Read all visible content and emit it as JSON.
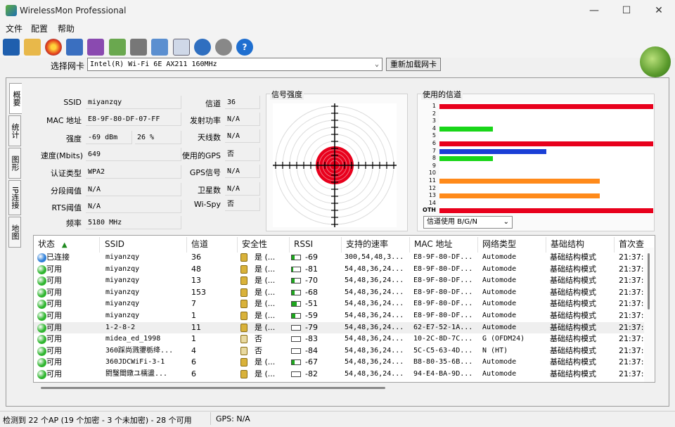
{
  "window": {
    "title": "WirelessMon Professional",
    "minimize": "—",
    "maximize": "☐",
    "close": "✕"
  },
  "menu": {
    "file": "文件",
    "config": "配置",
    "help": "帮助"
  },
  "adapter": {
    "label": "选择网卡",
    "value": "Intel(R) Wi-Fi 6E AX211 160MHz",
    "reload": "重新加载网卡"
  },
  "tabs": [
    "概要",
    "统计",
    "图形",
    "IP连接",
    "地图"
  ],
  "summary": {
    "ssid_label": "SSID",
    "ssid": "miyanzqy",
    "mac_label": "MAC 地址",
    "mac": "E8-9F-80-DF-07-FF",
    "strength_label": "强度",
    "strength_dbm": "-69 dBm",
    "strength_pct": "26 %",
    "speed_label": "速度(Mbits)",
    "speed": "649",
    "auth_label": "认证类型",
    "auth": "WPA2",
    "frag_label": "分段阈值",
    "frag": "N/A",
    "rts_label": "RTS阈值",
    "rts": "N/A",
    "freq_label": "频率",
    "freq": "5180 MHz",
    "channel_label": "信道",
    "channel": "36",
    "txpower_label": "发射功率",
    "txpower": "N/A",
    "antennas_label": "天线数",
    "antennas": "N/A",
    "gps_used_label": "使用的GPS",
    "gps_used": "否",
    "gps_signal_label": "GPS信号",
    "gps_signal": "N/A",
    "satellites_label": "卫星数",
    "satellites": "N/A",
    "wispy_label": "Wi-Spy",
    "wispy": "否"
  },
  "signal_panel": {
    "title": "信号强度"
  },
  "channels_panel": {
    "title": "使用的信道",
    "labels": [
      "1",
      "2",
      "3",
      "4",
      "5",
      "6",
      "7",
      "8",
      "9",
      "10",
      "11",
      "12",
      "13",
      "14",
      "OTH"
    ],
    "usage": [
      1.0,
      0,
      0,
      0.25,
      0,
      1.0,
      0.5,
      0.25,
      0,
      0,
      0.75,
      0,
      0.75,
      0,
      1.0
    ],
    "colors": [
      "#e8001c",
      "",
      "",
      "#19d619",
      "",
      "#e8001c",
      "#1a3fd6",
      "#19d619",
      "",
      "",
      "#ff8a1a",
      "",
      "#ff8a1a",
      "",
      "#e8001c"
    ],
    "filter": "信道使用 B/G/N"
  },
  "list": {
    "headers": [
      "状态",
      "SSID",
      "信道",
      "安全性",
      "RSSI",
      "支持的速率",
      "MAC 地址",
      "网络类型",
      "基础结构",
      "首次查"
    ],
    "rows": [
      {
        "status": "已连接",
        "status_color": "#2f7fd8",
        "ssid": "miyanzqy",
        "channel": "36",
        "sec": "是 (...",
        "rssi": "-69",
        "rssi_level": 0.3,
        "rates": "300,54,48,3...",
        "mac": "E8-9F-80-DF...",
        "nettype": "Automode",
        "infra": "基础结构模式",
        "first": "21:37:"
      },
      {
        "status": "可用",
        "status_color": "#2fb52f",
        "ssid": "miyanzqy",
        "channel": "48",
        "sec": "是 (...",
        "rssi": "-81",
        "rssi_level": 0.15,
        "rates": "54,48,36,24...",
        "mac": "E8-9F-80-DF...",
        "nettype": "Automode",
        "infra": "基础结构模式",
        "first": "21:37:"
      },
      {
        "status": "可用",
        "status_color": "#2fb52f",
        "ssid": "miyanzqy",
        "channel": "13",
        "sec": "是 (...",
        "rssi": "-70",
        "rssi_level": 0.3,
        "rates": "54,48,36,24...",
        "mac": "E8-9F-80-DF...",
        "nettype": "Automode",
        "infra": "基础结构模式",
        "first": "21:37:"
      },
      {
        "status": "可用",
        "status_color": "#2fb52f",
        "ssid": "miyanzqy",
        "channel": "153",
        "sec": "是 (...",
        "rssi": "-68",
        "rssi_level": 0.3,
        "rates": "54,48,36,24...",
        "mac": "E8-9F-80-DF...",
        "nettype": "Automode",
        "infra": "基础结构模式",
        "first": "21:37:"
      },
      {
        "status": "可用",
        "status_color": "#2fb52f",
        "ssid": "miyanzqy",
        "channel": "7",
        "sec": "是 (...",
        "rssi": "-51",
        "rssi_level": 0.6,
        "rates": "54,48,36,24...",
        "mac": "E8-9F-80-DF...",
        "nettype": "Automode",
        "infra": "基础结构模式",
        "first": "21:37:"
      },
      {
        "status": "可用",
        "status_color": "#2fb52f",
        "ssid": "miyanzqy",
        "channel": "1",
        "sec": "是 (...",
        "rssi": "-59",
        "rssi_level": 0.45,
        "rates": "54,48,36,24...",
        "mac": "E8-9F-80-DF...",
        "nettype": "Automode",
        "infra": "基础结构模式",
        "first": "21:37:"
      },
      {
        "status": "可用",
        "status_color": "#2fb52f",
        "ssid": "1-2-8-2",
        "channel": "11",
        "sec": "是 (...",
        "rssi": "-79",
        "rssi_level": 0.0,
        "rates": "54,48,36,24...",
        "mac": "62-E7-52-1A...",
        "nettype": "Automode",
        "infra": "基础结构模式",
        "first": "21:37:"
      },
      {
        "status": "可用",
        "status_color": "#2fb52f",
        "ssid": "midea_ed_1998",
        "channel": "1",
        "sec": "否",
        "rssi": "-83",
        "rssi_level": 0.0,
        "rates": "54,48,36,24...",
        "mac": "10-2C-8D-7C...",
        "nettype": "G (OFDM24)",
        "infra": "基础结构模式",
        "first": "21:37:"
      },
      {
        "status": "可用",
        "status_color": "#2fb52f",
        "ssid": "360踩尚溅瓕栃绛...",
        "channel": "4",
        "sec": "否",
        "rssi": "-84",
        "rssi_level": 0.0,
        "rates": "54,48,36,24...",
        "mac": "5C-C5-63-4D...",
        "nettype": "N (HT)",
        "infra": "基础结构模式",
        "first": "21:37:"
      },
      {
        "status": "可用",
        "status_color": "#2fb52f",
        "ssid": "360JDCWiFi-3-1",
        "channel": "6",
        "sec": "是 (...",
        "rssi": "-67",
        "rssi_level": 0.3,
        "rates": "54,48,36,24...",
        "mac": "B8-80-35-6B...",
        "nettype": "Automode",
        "infra": "基础结构模式",
        "first": "21:37:"
      },
      {
        "status": "可用",
        "status_color": "#2fb52f",
        "ssid": "閼瑿閸鐓ユ檽盪...",
        "channel": "6",
        "sec": "是 (...",
        "rssi": "-82",
        "rssi_level": 0.0,
        "rates": "54,48,36,24...",
        "mac": "94-E4-BA-9D...",
        "nettype": "Automode",
        "infra": "基础结构模式",
        "first": "21:37:"
      }
    ]
  },
  "status_bar": {
    "summary": "检测到 22 个AP (19 个加密 - 3 个未加密) - 28 个可用",
    "gps": "GPS: N/A"
  }
}
